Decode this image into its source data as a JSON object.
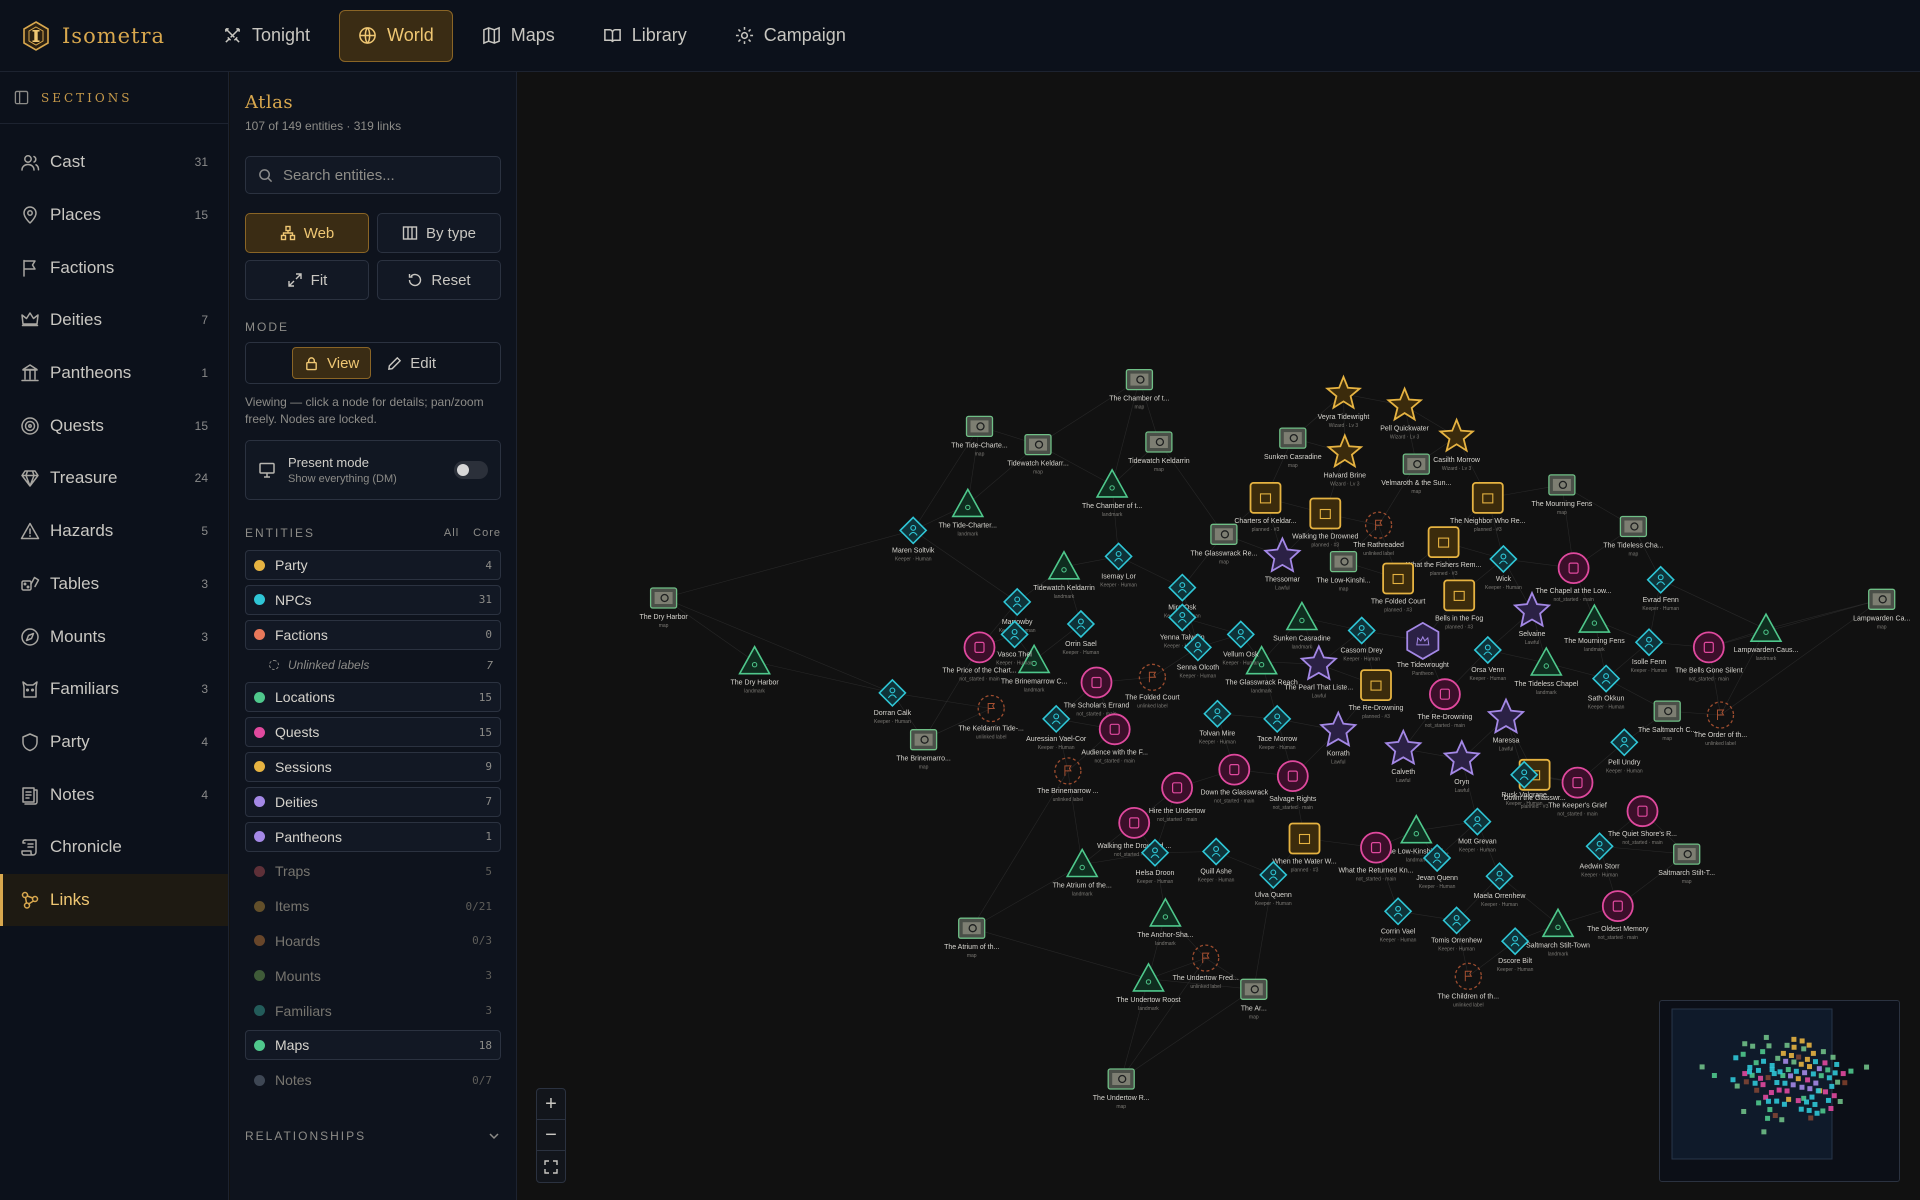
{
  "app": {
    "name": "Isometra"
  },
  "nav": [
    {
      "label": "Tonight",
      "icon": "swords-icon"
    },
    {
      "label": "World",
      "icon": "globe-icon",
      "active": true
    },
    {
      "label": "Maps",
      "icon": "map-icon"
    },
    {
      "label": "Library",
      "icon": "book-icon"
    },
    {
      "label": "Campaign",
      "icon": "gear-icon"
    }
  ],
  "sections": {
    "title": "Sections",
    "items": [
      {
        "label": "Cast",
        "count": "31",
        "icon": "people-icon"
      },
      {
        "label": "Places",
        "count": "15",
        "icon": "pin-icon"
      },
      {
        "label": "Factions",
        "count": "",
        "icon": "flag-icon"
      },
      {
        "label": "Deities",
        "count": "7",
        "icon": "crown-icon"
      },
      {
        "label": "Pantheons",
        "count": "1",
        "icon": "columns-icon"
      },
      {
        "label": "Quests",
        "count": "15",
        "icon": "target-icon"
      },
      {
        "label": "Treasure",
        "count": "24",
        "icon": "gem-icon"
      },
      {
        "label": "Hazards",
        "count": "5",
        "icon": "warning-icon"
      },
      {
        "label": "Tables",
        "count": "3",
        "icon": "dice-icon"
      },
      {
        "label": "Mounts",
        "count": "3",
        "icon": "compass-icon"
      },
      {
        "label": "Familiars",
        "count": "3",
        "icon": "cat-icon"
      },
      {
        "label": "Party",
        "count": "4",
        "icon": "shield-icon"
      },
      {
        "label": "Notes",
        "count": "4",
        "icon": "note-icon"
      },
      {
        "label": "Chronicle",
        "count": "",
        "icon": "scroll-icon"
      },
      {
        "label": "Links",
        "count": "",
        "icon": "links-icon",
        "active": true
      }
    ]
  },
  "atlas": {
    "title": "Atlas",
    "subtitle": "107 of 149 entities · 319 links",
    "search_placeholder": "Search entities...",
    "web_label": "Web",
    "bytype_label": "By type",
    "fit_label": "Fit",
    "reset_label": "Reset",
    "mode_label": "Mode",
    "view_label": "View",
    "edit_label": "Edit",
    "mode_help": "Viewing — click a node for details; pan/zoom freely. Nodes are locked.",
    "present_title": "Present mode",
    "present_sub": "Show everything (DM)",
    "entities_label": "Entities",
    "all_label": "All",
    "core_label": "Core",
    "relationships_label": "Relationships",
    "entities": [
      {
        "label": "Party",
        "count": "4",
        "color": "#e6b341",
        "on": true
      },
      {
        "label": "NPCs",
        "count": "31",
        "color": "#2fc6d6",
        "on": true
      },
      {
        "label": "Factions",
        "count": "0",
        "color": "#e8785a",
        "on": true
      },
      {
        "label": "Unlinked labels",
        "count": "7",
        "sub": true
      },
      {
        "label": "Locations",
        "count": "15",
        "color": "#4fc88c",
        "on": true
      },
      {
        "label": "Quests",
        "count": "15",
        "color": "#e0499e",
        "on": true
      },
      {
        "label": "Sessions",
        "count": "9",
        "color": "#e6b341",
        "on": true
      },
      {
        "label": "Deities",
        "count": "7",
        "color": "#a488e6",
        "on": true
      },
      {
        "label": "Pantheons",
        "count": "1",
        "color": "#a488e6",
        "on": true
      },
      {
        "label": "Traps",
        "count": "5",
        "color": "#c2555a",
        "on": false
      },
      {
        "label": "Items",
        "count": "0/21",
        "color": "#c99a3c",
        "on": false
      },
      {
        "label": "Hoards",
        "count": "0/3",
        "color": "#d8863c",
        "on": false
      },
      {
        "label": "Mounts",
        "count": "3",
        "color": "#7cb35a",
        "on": false
      },
      {
        "label": "Familiars",
        "count": "3",
        "color": "#3fb5a7",
        "on": false
      },
      {
        "label": "Maps",
        "count": "18",
        "color": "#4fc88c",
        "on": true
      },
      {
        "label": "Notes",
        "count": "0/7",
        "color": "#7a8899",
        "on": false
      }
    ]
  },
  "graph": {
    "colors": {
      "npc": "#2fc6d6",
      "quest": "#e0499e",
      "location": "#4fc88c",
      "session": "#e6b341",
      "party": "#e6b341",
      "deity": "#a488e6",
      "map": "#6fbf86",
      "faction": "#d8663c"
    },
    "nodes": [
      {
        "type": "map",
        "label": "The Tide-Charte..."
      },
      {
        "type": "map",
        "label": "The Chamber of t..."
      },
      {
        "type": "map",
        "label": "Tidewatch Keldarr..."
      },
      {
        "type": "map",
        "label": "Tidewatch Keldarrin"
      },
      {
        "type": "map",
        "label": "Sunken Casradine"
      },
      {
        "type": "map",
        "label": "Velmaroth & the Sun..."
      },
      {
        "type": "map",
        "label": "The Mourning Fens"
      },
      {
        "type": "map",
        "label": "The Tideless Cha..."
      },
      {
        "type": "map",
        "label": "The Glasswrack Re..."
      },
      {
        "type": "map",
        "label": "The Low-Kinshi..."
      },
      {
        "type": "map",
        "label": "The Dry Harbor"
      },
      {
        "type": "map",
        "label": "The Brinemarro..."
      },
      {
        "type": "map",
        "label": "The Saltmarch C..."
      },
      {
        "type": "map",
        "label": "Saltmarch Stilt-T..."
      },
      {
        "type": "map",
        "label": "The Atrium of th..."
      },
      {
        "type": "map",
        "label": "The Undertow R..."
      },
      {
        "type": "map",
        "label": "Lampwarden Ca..."
      },
      {
        "type": "map",
        "label": "The Ar..."
      },
      {
        "type": "party",
        "label": "Veyra Tidewright"
      },
      {
        "type": "party",
        "label": "Pell Quickwater"
      },
      {
        "type": "party",
        "label": "Halvard Brine"
      },
      {
        "type": "party",
        "label": "Casilth Morrow"
      },
      {
        "type": "session",
        "label": "Charters of Keldar..."
      },
      {
        "type": "session",
        "label": "Walking the Drowned"
      },
      {
        "type": "session",
        "label": "The Neighbor Who Re..."
      },
      {
        "type": "session",
        "label": "What the Fishers Rem..."
      },
      {
        "type": "session",
        "label": "The Folded Court"
      },
      {
        "type": "session",
        "label": "Bells in the Fog"
      },
      {
        "type": "session",
        "label": "The Re-Drowning"
      },
      {
        "type": "session",
        "label": "Down the Glasswr..."
      },
      {
        "type": "session",
        "label": "When the Water W..."
      },
      {
        "type": "location",
        "label": "The Chamber of t..."
      },
      {
        "type": "location",
        "label": "The Tide-Charter..."
      },
      {
        "type": "location",
        "label": "Tidewatch Keldarrin"
      },
      {
        "type": "location",
        "label": "The Brinemarrow C..."
      },
      {
        "type": "location",
        "label": "Sunken Casradine"
      },
      {
        "type": "location",
        "label": "The Glasswrack Reach"
      },
      {
        "type": "location",
        "label": "The Mourning Fens"
      },
      {
        "type": "location",
        "label": "The Tideless Chapel"
      },
      {
        "type": "location",
        "label": "Lampwarden Caus..."
      },
      {
        "type": "location",
        "label": "The Dry Harbor"
      },
      {
        "type": "location",
        "label": "The Low-Kinship H..."
      },
      {
        "type": "location",
        "label": "The Atrium of the..."
      },
      {
        "type": "location",
        "label": "The Anchor-Sha..."
      },
      {
        "type": "location",
        "label": "Saltmarch Stilt-Town"
      },
      {
        "type": "location",
        "label": "The Undertow Roost"
      },
      {
        "type": "deity",
        "label": "Thessomar"
      },
      {
        "type": "deity",
        "label": "The Pearl That Liste..."
      },
      {
        "type": "deity",
        "label": "Selvaine"
      },
      {
        "type": "deity",
        "label": "Korrath"
      },
      {
        "type": "deity",
        "label": "Calveth"
      },
      {
        "type": "deity",
        "label": "Oryn"
      },
      {
        "type": "deity",
        "label": "Maressa"
      },
      {
        "type": "pantheon",
        "label": "The Tidewrought"
      },
      {
        "type": "quest",
        "label": "The Price of the Chart..."
      },
      {
        "type": "quest",
        "label": "The Scholar's Errand"
      },
      {
        "type": "quest",
        "label": "Audience with the F..."
      },
      {
        "type": "quest",
        "label": "Walking the Drowned ..."
      },
      {
        "type": "quest",
        "label": "Down the Glasswrack"
      },
      {
        "type": "quest",
        "label": "Hire the Undertow"
      },
      {
        "type": "quest",
        "label": "Salvage Rights"
      },
      {
        "type": "quest",
        "label": "The Re-Drowning"
      },
      {
        "type": "quest",
        "label": "The Chapel at the Low..."
      },
      {
        "type": "quest",
        "label": "The Bells Gone Silent"
      },
      {
        "type": "quest",
        "label": "The Keeper's Grief"
      },
      {
        "type": "quest",
        "label": "The Quiet Shore's R..."
      },
      {
        "type": "quest",
        "label": "What the Returned Kn..."
      },
      {
        "type": "quest",
        "label": "The Oldest Memory"
      },
      {
        "type": "quest",
        "label": "The Tide That Staye..."
      },
      {
        "type": "npc",
        "label": "Maren Soltvik"
      },
      {
        "type": "npc",
        "label": "Marrowby"
      },
      {
        "type": "npc",
        "label": "Isemay Lor"
      },
      {
        "type": "npc",
        "label": "Mira Osk"
      },
      {
        "type": "npc",
        "label": "Yenna Talwhin"
      },
      {
        "type": "npc",
        "label": "Vasco Thel"
      },
      {
        "type": "npc",
        "label": "Orrin Sael"
      },
      {
        "type": "npc",
        "label": "Vellum Osk"
      },
      {
        "type": "npc",
        "label": "Senna Olcoth"
      },
      {
        "type": "npc",
        "label": "Cassom Drey"
      },
      {
        "type": "npc",
        "label": "Wick"
      },
      {
        "type": "npc",
        "label": "Evrad Fenn"
      },
      {
        "type": "npc",
        "label": "Orsa Venn"
      },
      {
        "type": "npc",
        "label": "Isolle Fenn"
      },
      {
        "type": "npc",
        "label": "Sath Okkun"
      },
      {
        "type": "npc",
        "label": "Dorran Calk"
      },
      {
        "type": "npc",
        "label": "Auressian Vael-Cor"
      },
      {
        "type": "npc",
        "label": "Tolvan Mire"
      },
      {
        "type": "npc",
        "label": "Tace Morrow"
      },
      {
        "type": "npc",
        "label": "Pell Undry"
      },
      {
        "type": "npc",
        "label": "Rusk Volgrane"
      },
      {
        "type": "npc",
        "label": "Helsa Droon"
      },
      {
        "type": "npc",
        "label": "Quill Ashe"
      },
      {
        "type": "npc",
        "label": "Ulva Quenn"
      },
      {
        "type": "npc",
        "label": "Mott Grevan"
      },
      {
        "type": "npc",
        "label": "Jevan Quenn"
      },
      {
        "type": "npc",
        "label": "Maela Orrenhew"
      },
      {
        "type": "npc",
        "label": "Aedwin Storr"
      },
      {
        "type": "npc",
        "label": "Corrin Vael"
      },
      {
        "type": "npc",
        "label": "Tomis Orrenhew"
      },
      {
        "type": "npc",
        "label": "Dscore Bilt"
      },
      {
        "type": "faction",
        "label": "The Keldarrin Tide-..."
      },
      {
        "type": "faction",
        "label": "The Brinemarrow ..."
      },
      {
        "type": "faction",
        "label": "The Undertow Fred..."
      },
      {
        "type": "faction",
        "label": "The Order of th..."
      },
      {
        "type": "faction",
        "label": "The Children of th..."
      },
      {
        "type": "faction",
        "label": "The Folded Court"
      },
      {
        "type": "faction",
        "label": "The Rathreaded"
      }
    ]
  }
}
